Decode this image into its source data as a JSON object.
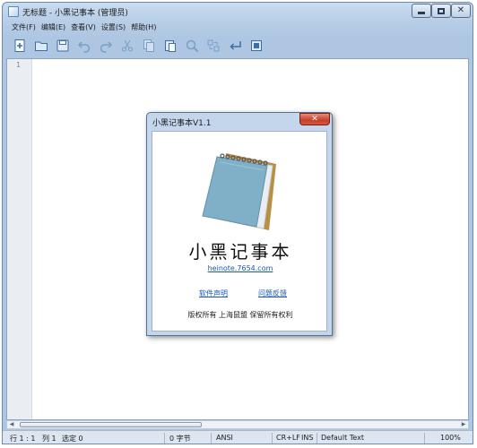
{
  "window": {
    "title": "无标题 - 小黑记事本 (管理员)"
  },
  "menu": [
    "文件(F)",
    "编辑(E)",
    "查看(V)",
    "设置(S)",
    "帮助(H)"
  ],
  "toolbar": [
    {
      "icon": "new-file-icon",
      "enabled": true
    },
    {
      "icon": "open-folder-icon",
      "enabled": true
    },
    {
      "icon": "save-icon",
      "enabled": true
    },
    {
      "icon": "undo-icon",
      "enabled": false
    },
    {
      "icon": "redo-icon",
      "enabled": false
    },
    {
      "icon": "cut-icon",
      "enabled": false
    },
    {
      "icon": "copy-icon",
      "enabled": false
    },
    {
      "icon": "paste-icon",
      "enabled": true
    },
    {
      "icon": "find-icon",
      "enabled": false
    },
    {
      "icon": "replace-icon",
      "enabled": false
    },
    {
      "icon": "goto-icon",
      "enabled": true
    },
    {
      "icon": "settings-icon",
      "enabled": true
    }
  ],
  "editor": {
    "line_number": "1"
  },
  "status": {
    "position": "行 1 : 1",
    "column": "列 1",
    "selected": "选定 0",
    "bytes": "0 字节",
    "encoding": "ANSI",
    "line_ending": "CR+LF",
    "insert_mode": "INS",
    "syntax": "Default Text",
    "zoom": "100%"
  },
  "about": {
    "title": "小黑记事本V1.1",
    "app_name": "小黑记事本",
    "website": "heinote.7654.com",
    "link_license": "软件声明",
    "link_feedback": "问题反馈",
    "copyright": "版权所有 上海鼠盟 保留所有权利"
  },
  "colors": {
    "link": "#1a55b8",
    "close_button": "#c4402a",
    "chrome": "#b7cde6",
    "notebook_cover": "#7fb0c8",
    "notebook_spine": "#c99a4a"
  }
}
